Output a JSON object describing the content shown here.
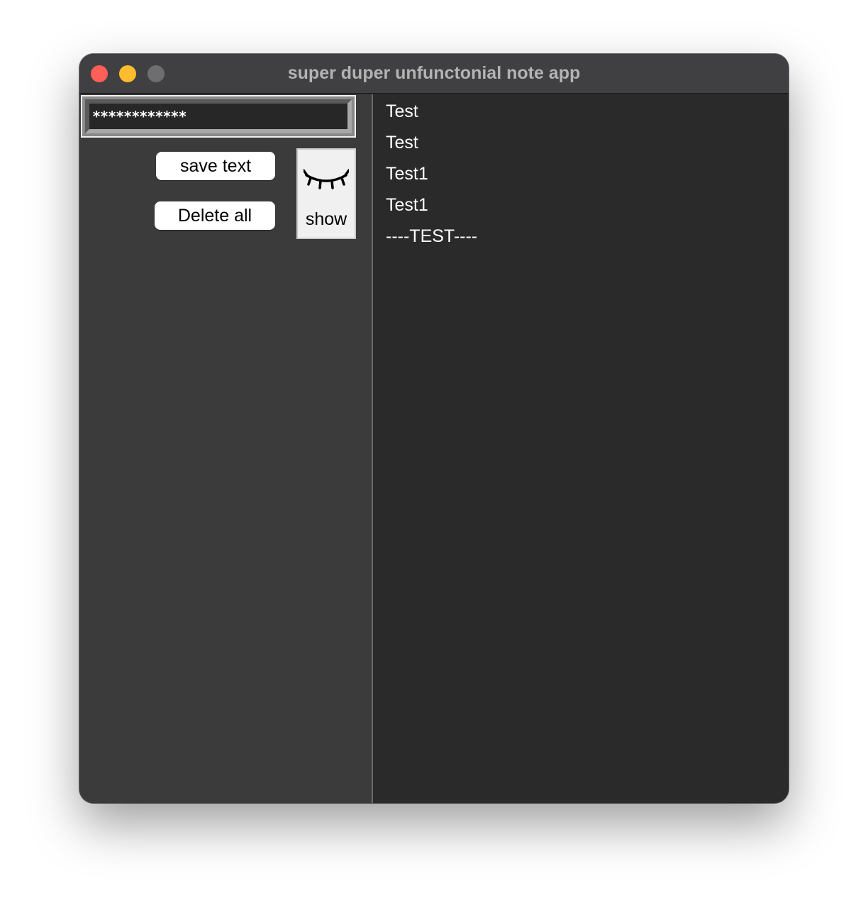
{
  "window": {
    "title": "super duper unfunctonial note app"
  },
  "entry": {
    "value": "************"
  },
  "buttons": {
    "save_label": "save text",
    "delete_label": "Delete all",
    "show_label": "show",
    "show_icon": "closed-eye-icon"
  },
  "notes": [
    "Test",
    "Test",
    "Test1",
    "Test1",
    "----TEST----"
  ],
  "colors": {
    "close": "#fe5f57",
    "minimize": "#febc2e",
    "zoom": "#6e6d70",
    "left_pane": "#3b3b3b",
    "right_pane": "#2a2a2a"
  }
}
